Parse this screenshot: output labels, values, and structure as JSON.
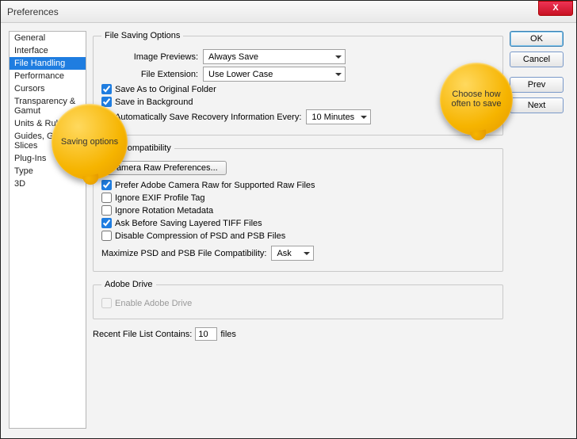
{
  "window": {
    "title": "Preferences",
    "close": "X"
  },
  "sidebar": {
    "items": [
      {
        "label": "General"
      },
      {
        "label": "Interface"
      },
      {
        "label": "File Handling",
        "selected": true
      },
      {
        "label": "Performance"
      },
      {
        "label": "Cursors"
      },
      {
        "label": "Transparency & Gamut"
      },
      {
        "label": "Units & Rulers"
      },
      {
        "label": "Guides, Grid & Slices"
      },
      {
        "label": "Plug-Ins"
      },
      {
        "label": "Type"
      },
      {
        "label": "3D"
      }
    ]
  },
  "buttons": {
    "ok": "OK",
    "cancel": "Cancel",
    "prev": "Prev",
    "next": "Next"
  },
  "saving": {
    "legend": "File Saving Options",
    "previews_label": "Image Previews:",
    "previews_value": "Always Save",
    "ext_label": "File Extension:",
    "ext_value": "Use Lower Case",
    "save_orig": "Save As to Original Folder",
    "save_bg": "Save in Background",
    "autosave": "Automatically Save Recovery Information Every:",
    "autosave_value": "10 Minutes"
  },
  "compat": {
    "legend": "File Compatibility",
    "camera_btn": "Camera Raw Preferences...",
    "prefer_acr": "Prefer Adobe Camera Raw for Supported Raw Files",
    "ignore_exif": "Ignore EXIF Profile Tag",
    "ignore_rot": "Ignore Rotation Metadata",
    "ask_tiff": "Ask Before Saving Layered TIFF Files",
    "disable_psd": "Disable Compression of PSD and PSB Files",
    "maximize_label": "Maximize PSD and PSB File Compatibility:",
    "maximize_value": "Ask"
  },
  "drive": {
    "legend": "Adobe Drive",
    "enable": "Enable Adobe Drive"
  },
  "recent": {
    "label_a": "Recent File List Contains:",
    "value": "10",
    "label_b": "files"
  },
  "callouts": {
    "saving": "Saving options",
    "autosave": "Choose how often to save"
  }
}
